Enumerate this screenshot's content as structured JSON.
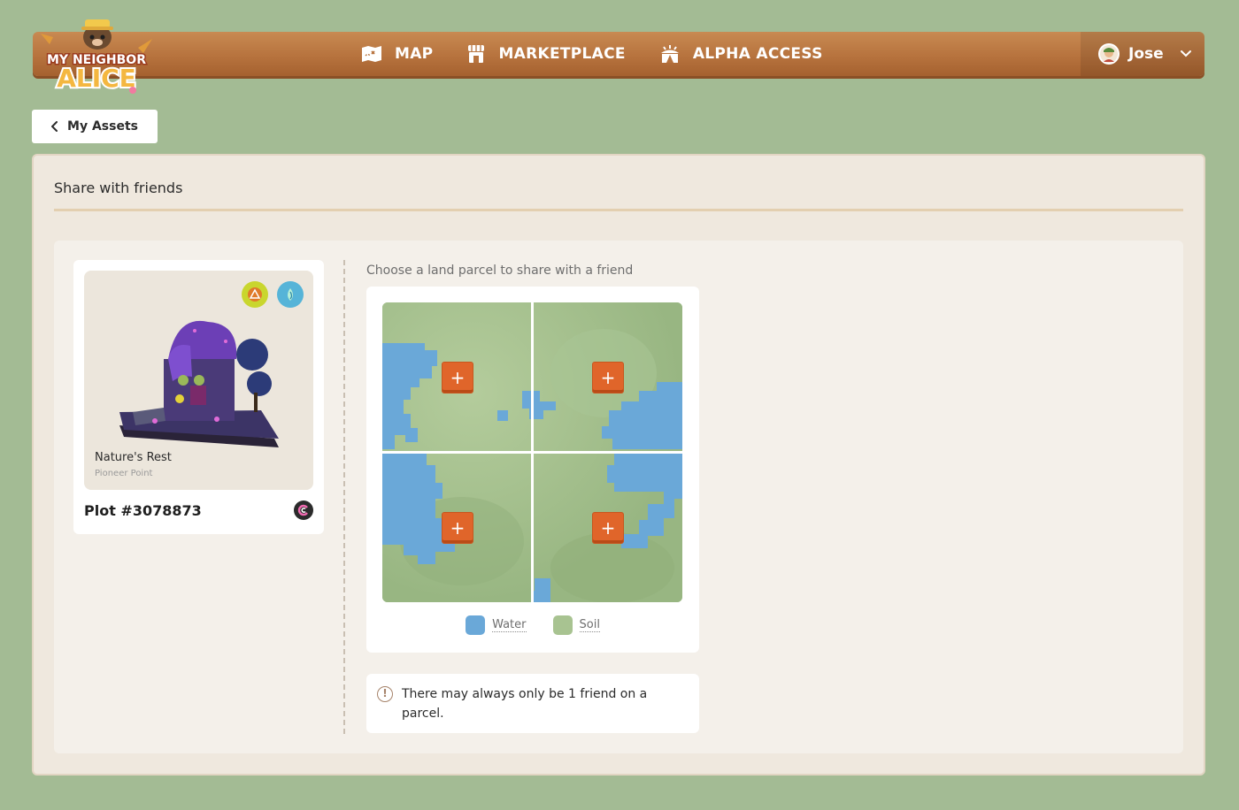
{
  "logo": {
    "line1": "MY NEIGHBOR",
    "line2": "ALICE"
  },
  "nav": {
    "items": [
      {
        "label": "MAP",
        "icon": "map-icon"
      },
      {
        "label": "MARKETPLACE",
        "icon": "store-icon"
      },
      {
        "label": "ALPHA ACCESS",
        "icon": "tent-icon"
      }
    ],
    "user": {
      "name": "Jose",
      "icon": "chevron-down-icon"
    }
  },
  "back_button": {
    "label": "My Assets"
  },
  "panel": {
    "title": "Share with friends",
    "asset": {
      "name": "Nature's Rest",
      "location": "Pioneer Point",
      "plot": "Plot #3078873",
      "badges": [
        "fire-element-icon",
        "water-element-icon"
      ]
    },
    "chooser": {
      "label": "Choose a land parcel to share with a friend",
      "parcels": [
        {
          "id": "top-left",
          "action": "+"
        },
        {
          "id": "top-right",
          "action": "+"
        },
        {
          "id": "bottom-left",
          "action": "+"
        },
        {
          "id": "bottom-right",
          "action": "+"
        }
      ],
      "legend": [
        {
          "label": "Water",
          "color": "#6aa8d8"
        },
        {
          "label": "Soil",
          "color": "#a8c391"
        }
      ]
    },
    "notice": "There may always only be 1 friend on a parcel."
  },
  "colors": {
    "background": "#a3bb94",
    "navbar": "#b7733e",
    "accent": "#e0652a",
    "water": "#6aa8d8",
    "soil": "#a8c391"
  }
}
